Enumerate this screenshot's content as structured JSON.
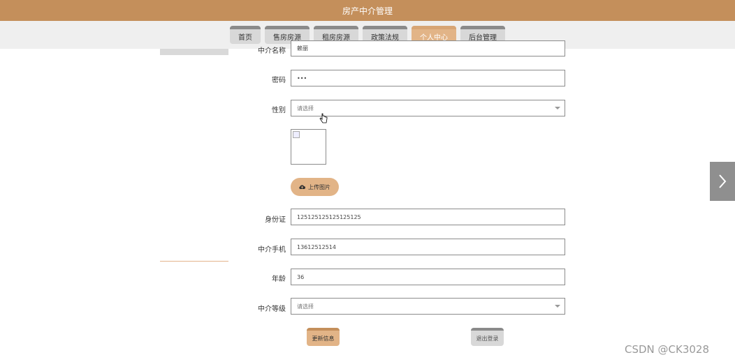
{
  "app": {
    "title": "房产中介管理"
  },
  "nav": [
    {
      "label": "首页",
      "active": false
    },
    {
      "label": "售房房源",
      "active": false
    },
    {
      "label": "租房房源",
      "active": false
    },
    {
      "label": "政策法规",
      "active": false
    },
    {
      "label": "个人中心",
      "active": true
    },
    {
      "label": "后台管理",
      "active": false
    }
  ],
  "form": {
    "agent_name": {
      "label": "中介名称",
      "value": "赖丽"
    },
    "password": {
      "label": "密码",
      "value": "•••"
    },
    "gender": {
      "label": "性别",
      "placeholder": "请选择"
    },
    "upload_label": "上传图片",
    "id_card": {
      "label": "身份证",
      "value": "125125125125125125"
    },
    "phone": {
      "label": "中介手机",
      "value": "13612512514"
    },
    "age": {
      "label": "年龄",
      "value": "36"
    },
    "level": {
      "label": "中介等级",
      "placeholder": "请选择"
    }
  },
  "actions": {
    "update": "更新信息",
    "logout": "退出登录"
  },
  "watermark": "CSDN @CK3028",
  "colors": {
    "brand": "#c48f5b",
    "accent": "#e2b487"
  }
}
